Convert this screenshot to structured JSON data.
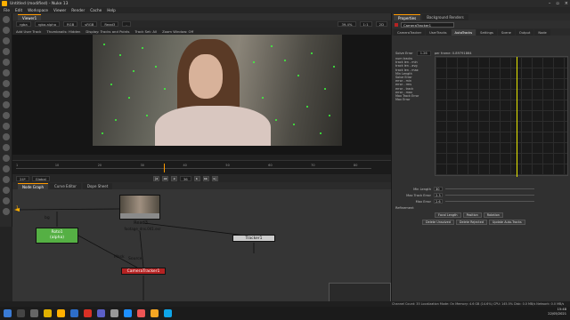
{
  "window": {
    "title": "Untitled (modified) - Nuke 13"
  },
  "menubar": [
    "File",
    "Edit",
    "Workspace",
    "Viewer",
    "Render",
    "Cache",
    "Help"
  ],
  "viewer": {
    "tabs": [
      "Viewer1"
    ],
    "channels": "rgba",
    "layer": "rgba.alpha",
    "colorspace": "RGB",
    "zoom_input": "sRGB",
    "input_a": "Read3",
    "input_b": "-",
    "zoom": "39.4%",
    "ratio": "1:1",
    "mode": "2D",
    "tracker_label": "Add User Track",
    "thumbnails_label": "Thumbnails: Hidden",
    "display_label": "Display: Tracks and Points",
    "tracker_type": "Track Set: All",
    "zoom_window": "Zoom Window: Off",
    "info_line": "HD_1080  1920x1080  Mean: 0 0 1920 1080  channels: rgb",
    "coord_text": "x=0 y=0",
    "frames": [
      "1",
      "10",
      "20",
      "30",
      "40",
      "50",
      "60",
      "70",
      "80"
    ],
    "transport": {
      "fps": "24*",
      "mode": "Global",
      "frame": "36"
    }
  },
  "nodegraph": {
    "tabs": [
      "Node Graph",
      "Curve Editor",
      "Dope Sheet"
    ],
    "nodes": {
      "roto": "Roto1\n(alpha)",
      "read": "Read3",
      "read_file": "footage_dns.041.exr",
      "tracker": "Tracker1",
      "cam": "CameraTracker1"
    },
    "edge_labels": {
      "bg": "bg",
      "mask": "Mask",
      "source": "Source",
      "one": "1"
    }
  },
  "properties": {
    "tabs": [
      "Properties",
      "Background Renders"
    ],
    "node_name": "CameraTracker1",
    "subtabs": [
      "CameraTracker",
      "UserTracks",
      "AutoTracks",
      "Settings",
      "Scene",
      "Output",
      "Node"
    ],
    "solve_error_label": "Solve Error",
    "solve_error_value": "1.26",
    "per_frame_label": "per frame: 0.89791864",
    "params": [
      "num tracks",
      "track len - min",
      "track len - avg",
      "track len - max",
      "Min Length",
      "Solve Error",
      "error - min",
      "error - rms",
      "error - track",
      "error - max",
      "Max Track Error",
      "Max Error"
    ],
    "controls": [
      {
        "label": "Min Length",
        "value": "30"
      },
      {
        "label": "Max Track Error",
        "value": "2.3"
      },
      {
        "label": "Max Error",
        "value": "2.6"
      }
    ],
    "refinement_label": "Refinement",
    "refine_buttons": [
      "Focal Length",
      "Position",
      "Rotation"
    ],
    "action_buttons": [
      "Delete Unsolved",
      "Delete Rejected",
      "Update Auto-Tracks"
    ]
  },
  "statusbar": {
    "text": "Channel Count: 35  Localization Mode: On  Memory: 4.6 GB (14.6%)  CPU: 145.5%  Disk: 0.0 MB/s  Network: 0.0 MB/s"
  },
  "taskbar": {
    "time": "15:48",
    "date": "22/05/2021"
  },
  "colors": {
    "accent": "#ff9a00",
    "roto": "#55b044",
    "camtracker": "#b52323",
    "tracker": "#cccccc",
    "trackpoint": "#3cff3c"
  }
}
